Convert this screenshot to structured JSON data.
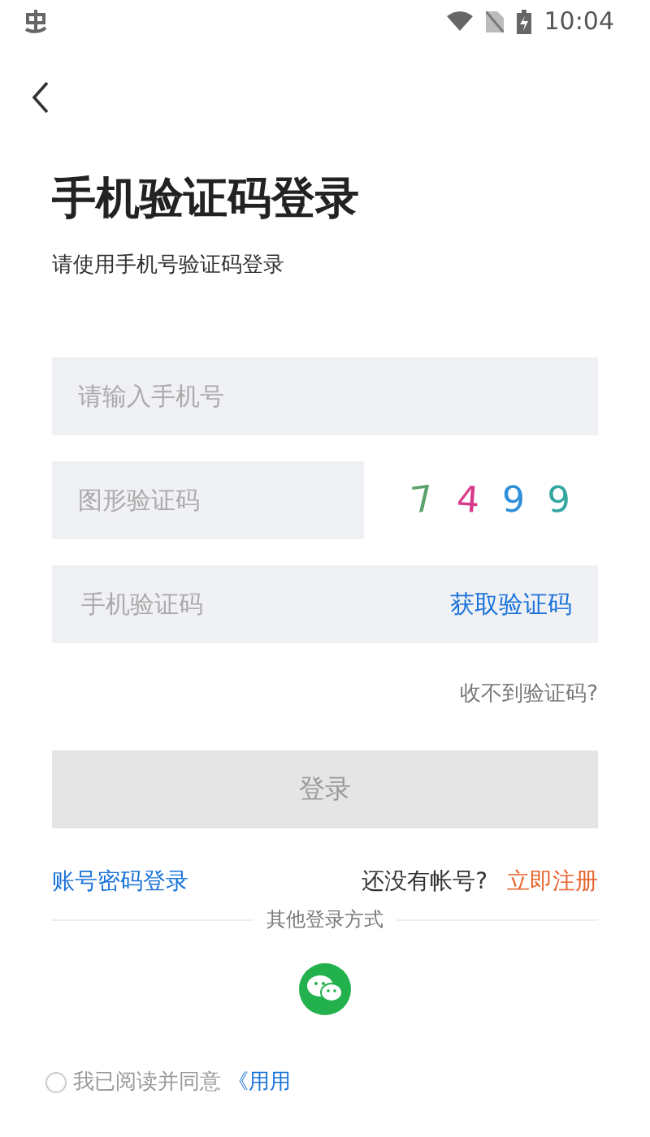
{
  "status_bar": {
    "time": "10:04"
  },
  "title": "手机验证码登录",
  "subtitle": "请使用手机号验证码登录",
  "fields": [
    {
      "kind": "plain",
      "placeholder": "请输入手机号"
    },
    {
      "kind": "captcha",
      "placeholder": "图形验证码",
      "captcha": [
        "7",
        "4",
        "9",
        "9"
      ]
    },
    {
      "kind": "sms",
      "placeholder": "手机验证码",
      "action": "获取验证码"
    }
  ],
  "help_link": "收不到验证码?",
  "login_button": {
    "label": "登录",
    "disabled": true
  },
  "password_login": "账号密码登录",
  "register_prompt": "还没有帐号?",
  "register_link": "立即注册",
  "other_methods": "其他登录方式",
  "agreement": {
    "checked": false,
    "text": "我已阅读并同意",
    "link": "《用用"
  }
}
